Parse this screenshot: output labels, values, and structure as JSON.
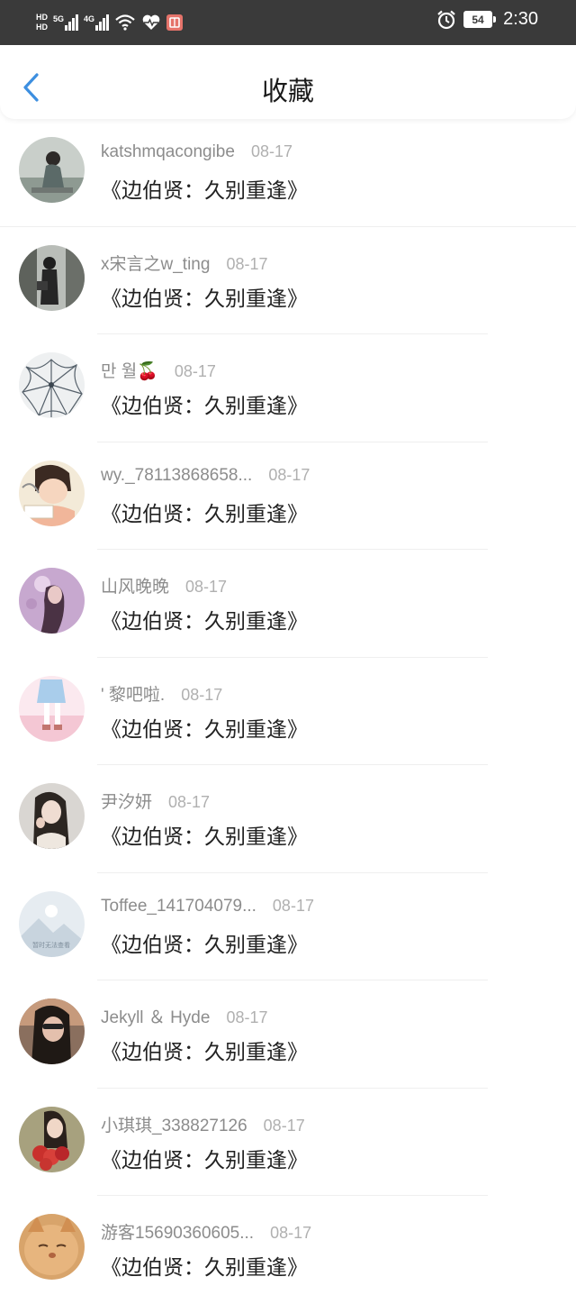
{
  "status_bar": {
    "time": "2:30",
    "battery": "54",
    "signal_1_label": "5G",
    "signal_2_label": "4G",
    "hd_1": "HD",
    "hd_2": "HD"
  },
  "header": {
    "title": "收藏",
    "back_icon": "chevron-left-icon",
    "accent": "#3d8fe0"
  },
  "items": [
    {
      "name": "katshmqacongibe",
      "date": "08-17",
      "work": "《边伯贤：久别重逢》"
    },
    {
      "name": "x宋言之w_ting",
      "date": "08-17",
      "work": "《边伯贤：久别重逢》"
    },
    {
      "name": "만 월🍒",
      "date": "08-17",
      "work": "《边伯贤：久别重逢》"
    },
    {
      "name": "wy._78113868658...",
      "date": "08-17",
      "work": "《边伯贤：久别重逢》"
    },
    {
      "name": "山风晚晚",
      "date": "08-17",
      "work": "《边伯贤：久别重逢》"
    },
    {
      "name": "' 黎吧啦.",
      "date": "08-17",
      "work": "《边伯贤：久别重逢》"
    },
    {
      "name": "尹汐妍",
      "date": "08-17",
      "work": "《边伯贤：久别重逢》"
    },
    {
      "name": "Toffee_141704079...",
      "date": "08-17",
      "work": "《边伯贤：久别重逢》"
    },
    {
      "name": "Jekyll ＆ Hyde",
      "date": "08-17",
      "work": "《边伯贤：久别重逢》"
    },
    {
      "name": "小琪琪_338827126",
      "date": "08-17",
      "work": "《边伯贤：久别重逢》"
    },
    {
      "name": "游客15690360605...",
      "date": "08-17",
      "work": "《边伯贤：久别重逢》"
    }
  ],
  "placeholder_avatar_text": "暂时无法查看"
}
